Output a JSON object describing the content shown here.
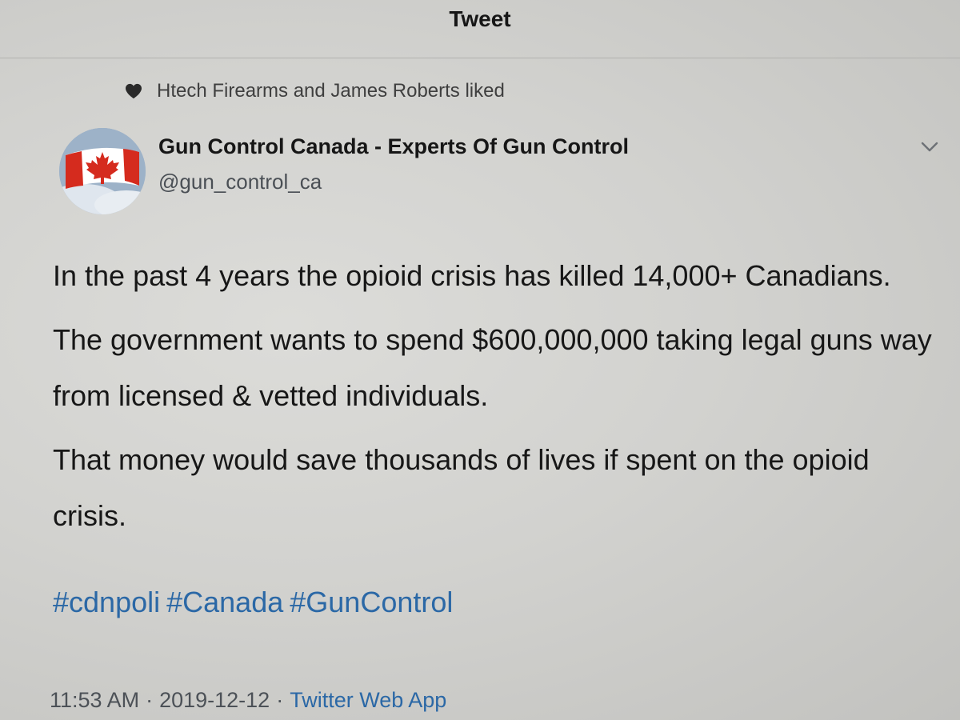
{
  "topbar": {
    "title": "Tweet"
  },
  "social_context": {
    "icon": "heart-icon",
    "text": "Htech Firearms and James Roberts liked"
  },
  "author": {
    "name": "Gun Control Canada - Experts Of Gun Control",
    "handle": "@gun_control_ca",
    "avatar_icon": "canadian-flag-icon"
  },
  "tweet": {
    "paragraphs": [
      "In the past 4 years the opioid crisis has killed 14,000+ Canadians.",
      "The government wants to spend $600,000,000 taking legal guns way from licensed & vetted individuals.",
      "That money would save thousands of lives if spent on the opioid crisis."
    ],
    "hashtags": [
      "#cdnpoli",
      "#Canada",
      "#GunControl"
    ]
  },
  "meta": {
    "time": "11:53 AM",
    "separator": "·",
    "date": "2019-12-12",
    "source": "Twitter Web App"
  },
  "colors": {
    "link": "#2b68a6",
    "flag_red": "#d52b1e",
    "background": "#d2d2cf"
  }
}
